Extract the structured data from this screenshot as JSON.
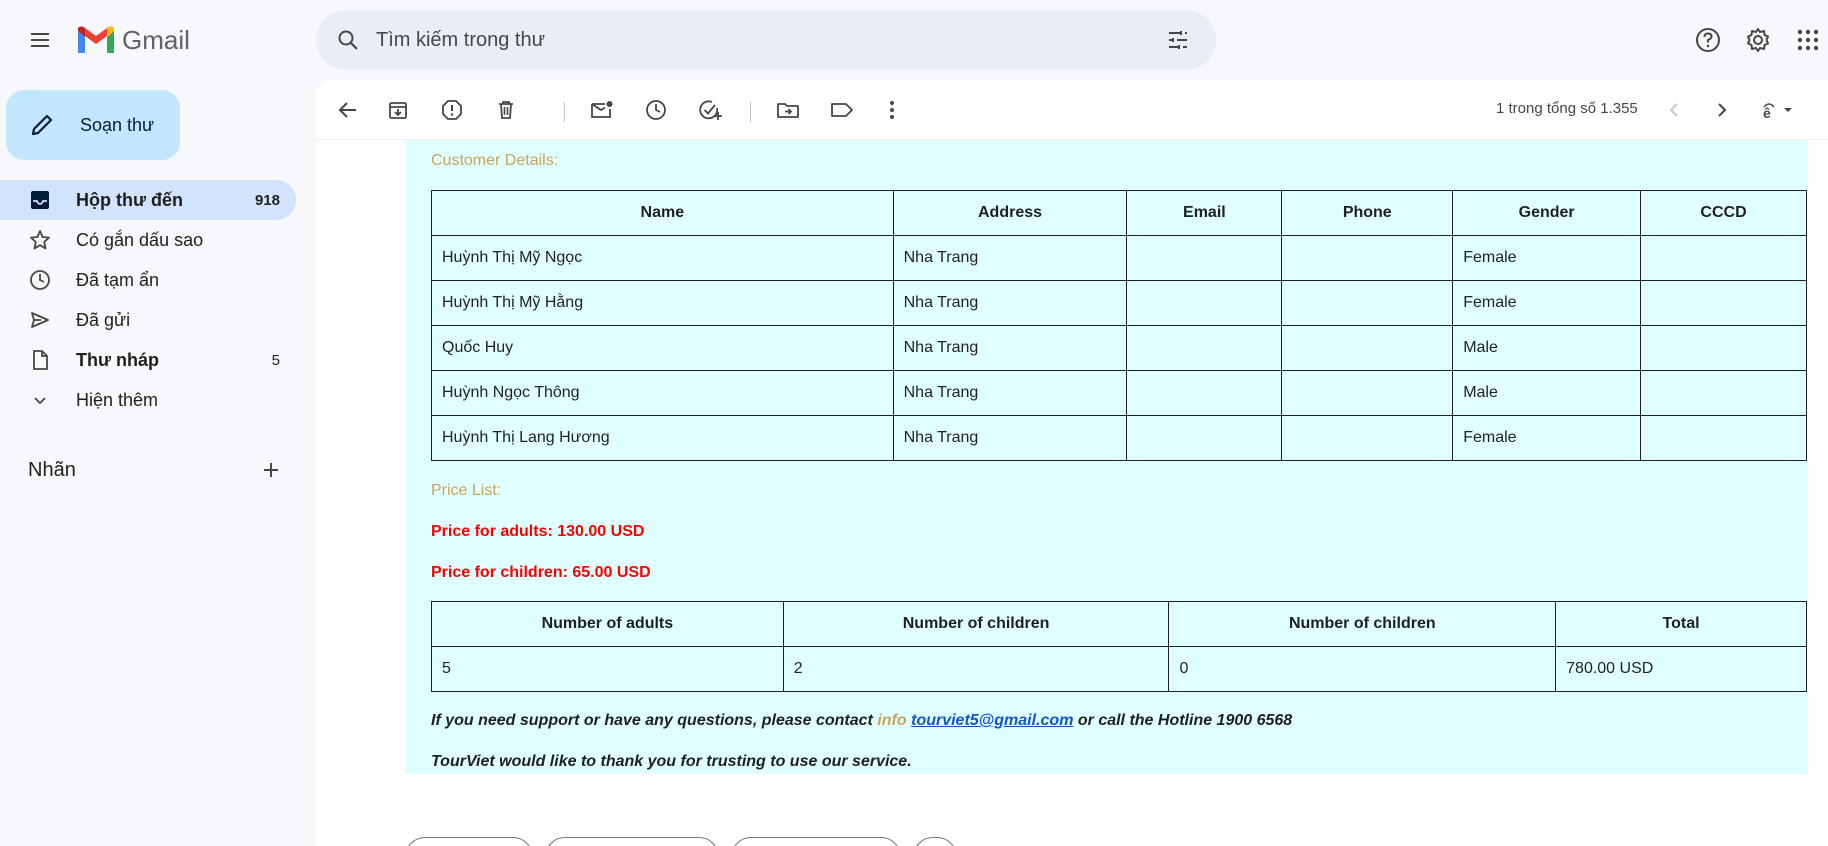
{
  "app": {
    "name": "Gmail"
  },
  "search": {
    "placeholder": "Tìm kiếm trong thư"
  },
  "sidebar": {
    "compose_label": "Soạn thư",
    "items": [
      {
        "label": "Hộp thư đến",
        "count": "918"
      },
      {
        "label": "Có gắn dấu sao",
        "count": ""
      },
      {
        "label": "Đã tạm ẩn",
        "count": ""
      },
      {
        "label": "Đã gửi",
        "count": ""
      },
      {
        "label": "Thư nháp",
        "count": "5"
      },
      {
        "label": "Hiện thêm",
        "count": ""
      }
    ],
    "labels_title": "Nhãn"
  },
  "toolbar": {
    "pager": "1 trong tổng số 1.355"
  },
  "email": {
    "customer_title": "Customer Details:",
    "customer_headers": [
      "Name",
      "Address",
      "Email",
      "Phone",
      "Gender",
      "CCCD"
    ],
    "customers": [
      [
        "Huỳnh Thị Mỹ Ngọc",
        "Nha Trang",
        "",
        "",
        "Female",
        ""
      ],
      [
        "Huỳnh Thị Mỹ Hằng",
        "Nha Trang",
        "",
        "",
        "Female",
        ""
      ],
      [
        "Quốc Huy",
        "Nha Trang",
        "",
        "",
        "Male",
        ""
      ],
      [
        "Huỳnh Ngọc Thông",
        "Nha Trang",
        "",
        "",
        "Male",
        ""
      ],
      [
        "Huỳnh Thị Lang Hương",
        "Nha Trang",
        "",
        "",
        "Female",
        ""
      ]
    ],
    "price_title": "Price List:",
    "price_adults": "Price for adults: 130.00 USD",
    "price_children": "Price for children: 65.00 USD",
    "summary_headers": [
      "Number of adults",
      "Number of children",
      "Number of children",
      "Total"
    ],
    "summary_row": [
      "5",
      "2",
      "0",
      "780.00 USD"
    ],
    "support_prefix": "If you need support or have any questions, please contact ",
    "support_info": "info",
    "support_email": "tourviet5@gmail.com",
    "support_suffix": " or call the Hotline 1900 6568",
    "thanks": "TourViet would like to thank you for trusting to use our service."
  },
  "colors": {
    "accent": "#c2e7ff",
    "active_nav": "#d3e3fd",
    "email_bg": "#e0ffff",
    "price": "#ff0000",
    "label_gold": "#c9a45c"
  }
}
